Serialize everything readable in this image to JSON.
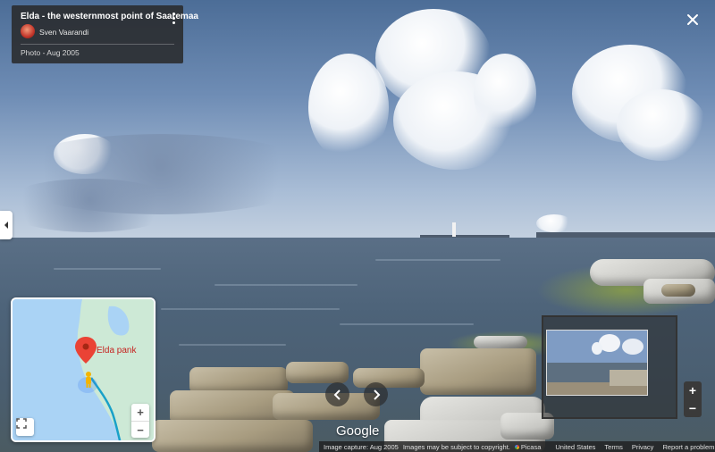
{
  "photo": {
    "title": "Elda - the westernmost point of Saaremaa",
    "author": "Sven Vaarandi",
    "date_text": "Photo - Aug 2005"
  },
  "icons": {
    "close": "close-icon",
    "more": "more-vert-icon",
    "collapse": "chevron-left-icon",
    "prev": "chevron-left-icon",
    "next": "chevron-right-icon",
    "fullscreen": "fullscreen-icon",
    "pin": "map-pin-icon",
    "pegman": "pegman-icon"
  },
  "minimap": {
    "pin_label": "Elda pank",
    "zoom_in": "+",
    "zoom_out": "−"
  },
  "zoom": {
    "in": "+",
    "out": "−"
  },
  "branding": {
    "logo": "Google"
  },
  "footer": {
    "capture": "Image capture: Aug 2005",
    "copyright": "Images may be subject to copyright.",
    "provider": "Picasa",
    "country": "United States",
    "terms": "Terms",
    "privacy": "Privacy",
    "report": "Report a problem"
  },
  "colors": {
    "pin": "#ea4335",
    "panel_bg": "#282828",
    "water": "#aad3f5",
    "land": "#cde9d6",
    "route": "#19a1c8"
  }
}
